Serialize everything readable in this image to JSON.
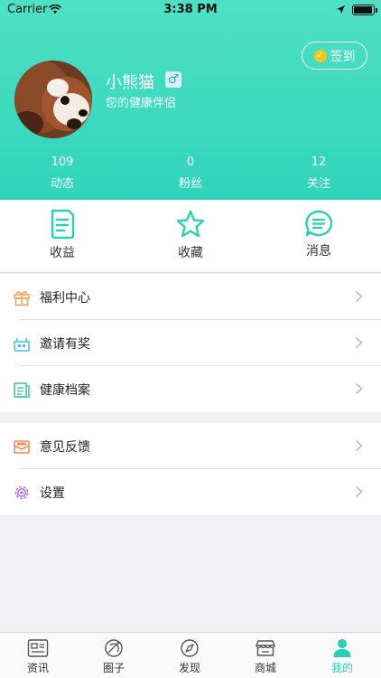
{
  "status_bar": {
    "carrier": "Carrier",
    "time": "3:38 PM"
  },
  "profile": {
    "checkin_label": "签到",
    "name": "小熊猫",
    "gender_symbol": "♂",
    "tagline": "您的健康伴侣",
    "stats": [
      {
        "value": "109",
        "label": "动态"
      },
      {
        "value": "0",
        "label": "粉丝"
      },
      {
        "value": "12",
        "label": "关注"
      }
    ]
  },
  "actions": [
    {
      "label": "收益",
      "icon": "document-icon"
    },
    {
      "label": "收藏",
      "icon": "star-icon"
    },
    {
      "label": "消息",
      "icon": "message-icon"
    }
  ],
  "menu_group_1": [
    {
      "label": "福利中心",
      "icon": "gift-icon",
      "color": "#f5a45a"
    },
    {
      "label": "邀请有奖",
      "icon": "basket-icon",
      "color": "#47c2e8"
    },
    {
      "label": "健康档案",
      "icon": "file-icon",
      "color": "#3ec9a9"
    }
  ],
  "menu_group_2": [
    {
      "label": "意见反馈",
      "icon": "mail-icon",
      "color": "#f28a5a"
    },
    {
      "label": "设置",
      "icon": "gear-icon",
      "color": "#b27ae0"
    }
  ],
  "tabs": [
    {
      "label": "资讯",
      "icon": "news-icon"
    },
    {
      "label": "圈子",
      "icon": "circle-icon"
    },
    {
      "label": "发现",
      "icon": "compass-icon"
    },
    {
      "label": "商城",
      "icon": "store-icon"
    },
    {
      "label": "我的",
      "icon": "person-icon",
      "active": true
    }
  ],
  "colors": {
    "accent": "#2ccfb4",
    "header_top": "#4fe0c4",
    "header_bottom": "#2fd4bb"
  }
}
